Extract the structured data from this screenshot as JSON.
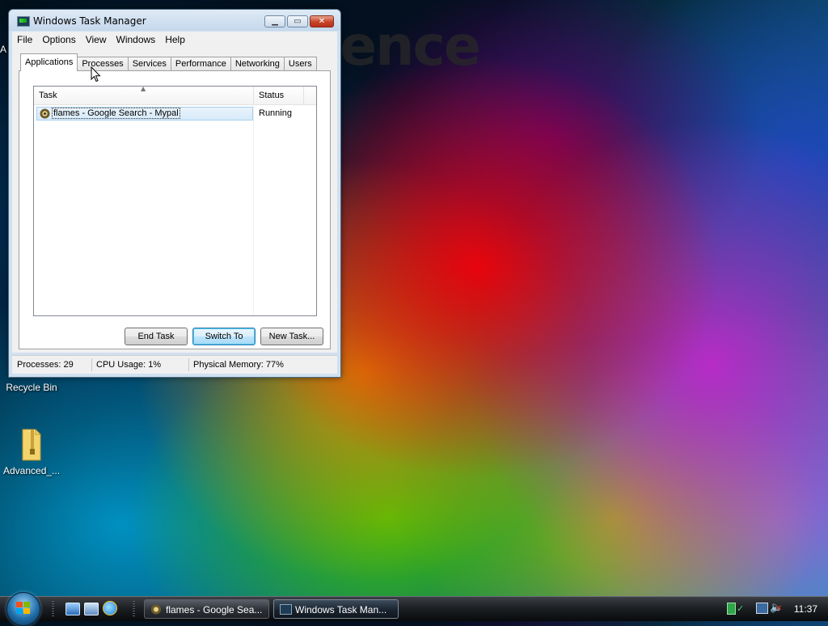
{
  "wallpaper": {
    "text": "ence"
  },
  "desktop": {
    "edge_label": "A",
    "icons": [
      {
        "label": "Recycle Bin",
        "icon": "recycle-bin-icon"
      },
      {
        "label": "Advanced_...",
        "icon": "zip-folder-icon"
      }
    ]
  },
  "window": {
    "title": "Windows Task Manager",
    "menu": [
      "File",
      "Options",
      "View",
      "Windows",
      "Help"
    ],
    "tabs": [
      "Applications",
      "Processes",
      "Services",
      "Performance",
      "Networking",
      "Users"
    ],
    "active_tab": "Applications",
    "columns": {
      "task": "Task",
      "status": "Status"
    },
    "rows": [
      {
        "task": "flames - Google Search - Mypal",
        "status": "Running",
        "icon": "mypal-browser-icon"
      }
    ],
    "buttons": {
      "end_task": "End Task",
      "switch_to": "Switch To",
      "new_task": "New Task..."
    },
    "status_bar": {
      "processes": "Processes: 29",
      "cpu": "CPU Usage: 1%",
      "memory": "Physical Memory: 77%"
    }
  },
  "taskbar": {
    "tasks": [
      {
        "label": "flames - Google Sea...",
        "icon": "mypal-browser-icon",
        "active": false
      },
      {
        "label": "Windows Task Man...",
        "icon": "task-manager-icon",
        "active": true
      }
    ],
    "clock": "11:37",
    "colors": {
      "taskbar": "#1d2024",
      "selection": "#d7eaf9",
      "close_button": "#c6432a"
    }
  }
}
